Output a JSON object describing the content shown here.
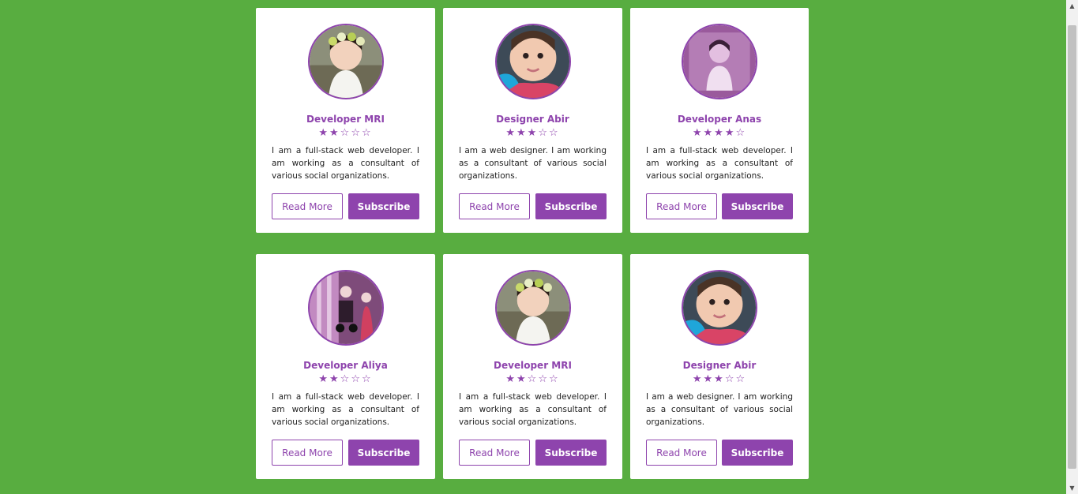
{
  "accent_color": "#8e44ad",
  "background_color": "#58ad40",
  "cards": [
    {
      "name": "Developer MRI",
      "rating": 2,
      "description": "I am a full-stack web developer. I am working as a consultant of various social organizations.",
      "read_more": "Read More",
      "subscribe": "Subscribe",
      "photo": "girl-flower-crown"
    },
    {
      "name": "Designer Abir",
      "rating": 3,
      "description": "I am a web designer. I am working as a consultant of various social organizations.",
      "read_more": "Read More",
      "subscribe": "Subscribe",
      "photo": "baby-closeup"
    },
    {
      "name": "Developer Anas",
      "rating": 4,
      "description": "I am a full-stack web developer. I am working as a consultant of various social organizations.",
      "read_more": "Read More",
      "subscribe": "Subscribe",
      "photo": "girl-purple-tint"
    },
    {
      "name": "Developer Aliya",
      "rating": 2,
      "description": "I am a full-stack web developer. I am working as a consultant of various social organizations.",
      "read_more": "Read More",
      "subscribe": "Subscribe",
      "photo": "girl-stroller"
    },
    {
      "name": "Developer MRI",
      "rating": 2,
      "description": "I am a full-stack web developer. I am working as a consultant of various social organizations.",
      "read_more": "Read More",
      "subscribe": "Subscribe",
      "photo": "girl-flower-crown"
    },
    {
      "name": "Designer Abir",
      "rating": 3,
      "description": "I am a web designer. I am working as a consultant of various social organizations.",
      "read_more": "Read More",
      "subscribe": "Subscribe",
      "photo": "baby-closeup"
    }
  ],
  "max_rating": 5,
  "star_full": "★",
  "star_empty": "☆",
  "scroll_up_icon": "▲",
  "scroll_down_icon": "▼"
}
